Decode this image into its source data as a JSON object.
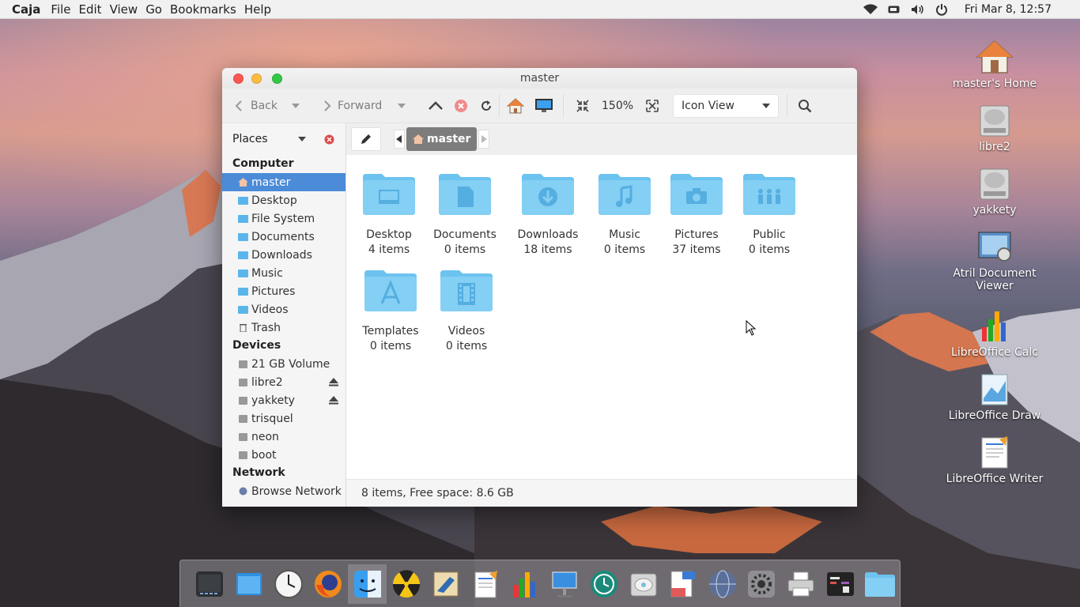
{
  "topbar": {
    "app_name": "Caja",
    "menus": [
      "File",
      "Edit",
      "View",
      "Go",
      "Bookmarks",
      "Help"
    ],
    "clock": "Fri Mar  8, 12:57",
    "tray_icons": [
      "wifi-icon",
      "battery-icon",
      "volume-icon",
      "power-icon"
    ]
  },
  "desktop": {
    "icons": [
      {
        "label": "master's Home",
        "icon": "home-icon"
      },
      {
        "label": "libre2",
        "icon": "drive-icon"
      },
      {
        "label": "yakkety",
        "icon": "drive-icon"
      },
      {
        "label": "Atril Document Viewer",
        "icon": "atril-icon"
      },
      {
        "label": "LibreOffice Calc",
        "icon": "calc-icon"
      },
      {
        "label": "LibreOffice Draw",
        "icon": "draw-icon"
      },
      {
        "label": "LibreOffice Writer",
        "icon": "writer-icon"
      }
    ]
  },
  "window": {
    "title": "master",
    "toolbar": {
      "back_label": "Back",
      "forward_label": "Forward",
      "zoom": "150%",
      "view_mode": "Icon View"
    },
    "sidebar": {
      "header": "Places",
      "sections": [
        {
          "title": "Computer",
          "items": [
            "master",
            "Desktop",
            "File System",
            "Documents",
            "Downloads",
            "Music",
            "Pictures",
            "Videos",
            "Trash"
          ]
        },
        {
          "title": "Devices",
          "items": [
            "21 GB Volume",
            "libre2",
            "yakkety",
            "trisquel",
            "neon",
            "boot"
          ]
        },
        {
          "title": "Network",
          "items": [
            "Browse Network"
          ]
        }
      ],
      "selected": "master"
    },
    "pathbar": {
      "current": "master"
    },
    "files": [
      {
        "name": "Desktop",
        "count": "4 items",
        "icon": "desktop-folder-icon"
      },
      {
        "name": "Documents",
        "count": "0 items",
        "icon": "documents-folder-icon"
      },
      {
        "name": "Downloads",
        "count": "18 items",
        "icon": "downloads-folder-icon"
      },
      {
        "name": "Music",
        "count": "0 items",
        "icon": "music-folder-icon"
      },
      {
        "name": "Pictures",
        "count": "37 items",
        "icon": "pictures-folder-icon"
      },
      {
        "name": "Public",
        "count": "0 items",
        "icon": "public-folder-icon"
      },
      {
        "name": "Templates",
        "count": "0 items",
        "icon": "templates-folder-icon"
      },
      {
        "name": "Videos",
        "count": "0 items",
        "icon": "videos-folder-icon"
      }
    ],
    "status": "8 items, Free space: 8.6 GB"
  },
  "dock": {
    "items": [
      "terminal-icon",
      "window-icon",
      "clock-icon",
      "firefox-icon",
      "finder-icon",
      "radiation-icon",
      "mail-icon",
      "writer-icon",
      "calc-icon",
      "keynote-icon",
      "timemachine-icon",
      "disk-utility-icon",
      "filer-icon",
      "network-globe-icon",
      "settings-icon",
      "printer-icon",
      "code-editor-icon",
      "folder-icon"
    ]
  },
  "colors": {
    "selection": "#4b8bd8",
    "folder": "#6cc3ef",
    "close": "#fc5753",
    "minimize": "#fdbc40",
    "maximize": "#33c748"
  }
}
